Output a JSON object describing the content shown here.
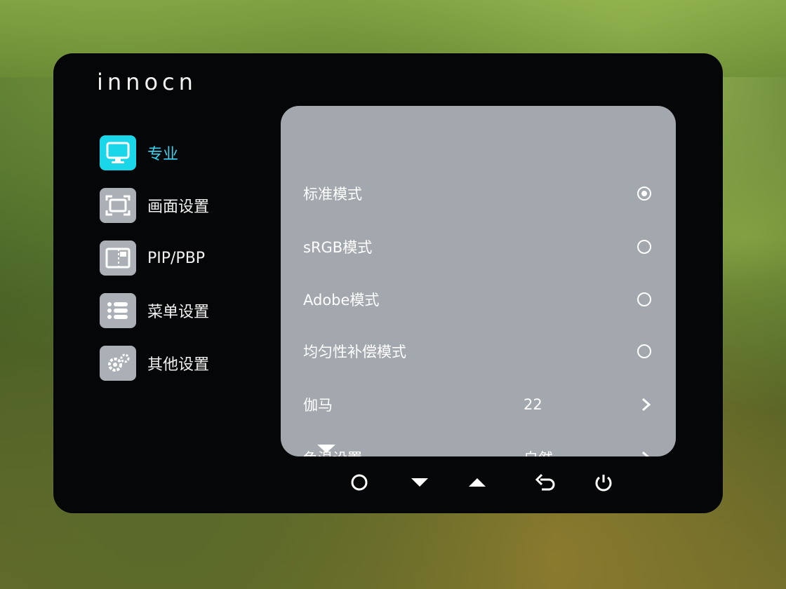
{
  "brand": {
    "logo_text": "innocn"
  },
  "nav": {
    "items": [
      {
        "label": "专业",
        "icon": "monitor-icon",
        "active": true
      },
      {
        "label": "画面设置",
        "icon": "screen-frame-icon",
        "active": false
      },
      {
        "label": "PIP/PBP",
        "icon": "pip-icon",
        "active": false
      },
      {
        "label": "菜单设置",
        "icon": "menu-list-icon",
        "active": false
      },
      {
        "label": "其他设置",
        "icon": "gear-icon",
        "active": false
      }
    ]
  },
  "panel": {
    "rows": [
      {
        "label": "标准模式",
        "type": "radio",
        "checked": true
      },
      {
        "label": "sRGB模式",
        "type": "radio",
        "checked": false
      },
      {
        "label": "Adobe模式",
        "type": "radio",
        "checked": false
      },
      {
        "label": "均匀性补偿模式",
        "type": "radio",
        "checked": false
      },
      {
        "label": "伽马",
        "type": "submenu",
        "value": "22"
      },
      {
        "label": "色温设置",
        "type": "submenu",
        "value": "自然"
      }
    ],
    "scroll_indicator_icon": "scroll-down-triangle-icon"
  },
  "controls": {
    "buttons": [
      {
        "icon": "circle-ok-icon"
      },
      {
        "icon": "arrow-down-icon"
      },
      {
        "icon": "arrow-up-icon"
      },
      {
        "icon": "back-icon"
      },
      {
        "icon": "power-icon"
      }
    ]
  },
  "colors": {
    "accent": "#19d6e8",
    "panel": "#a3a8ae",
    "osd_bg": "#050607"
  }
}
